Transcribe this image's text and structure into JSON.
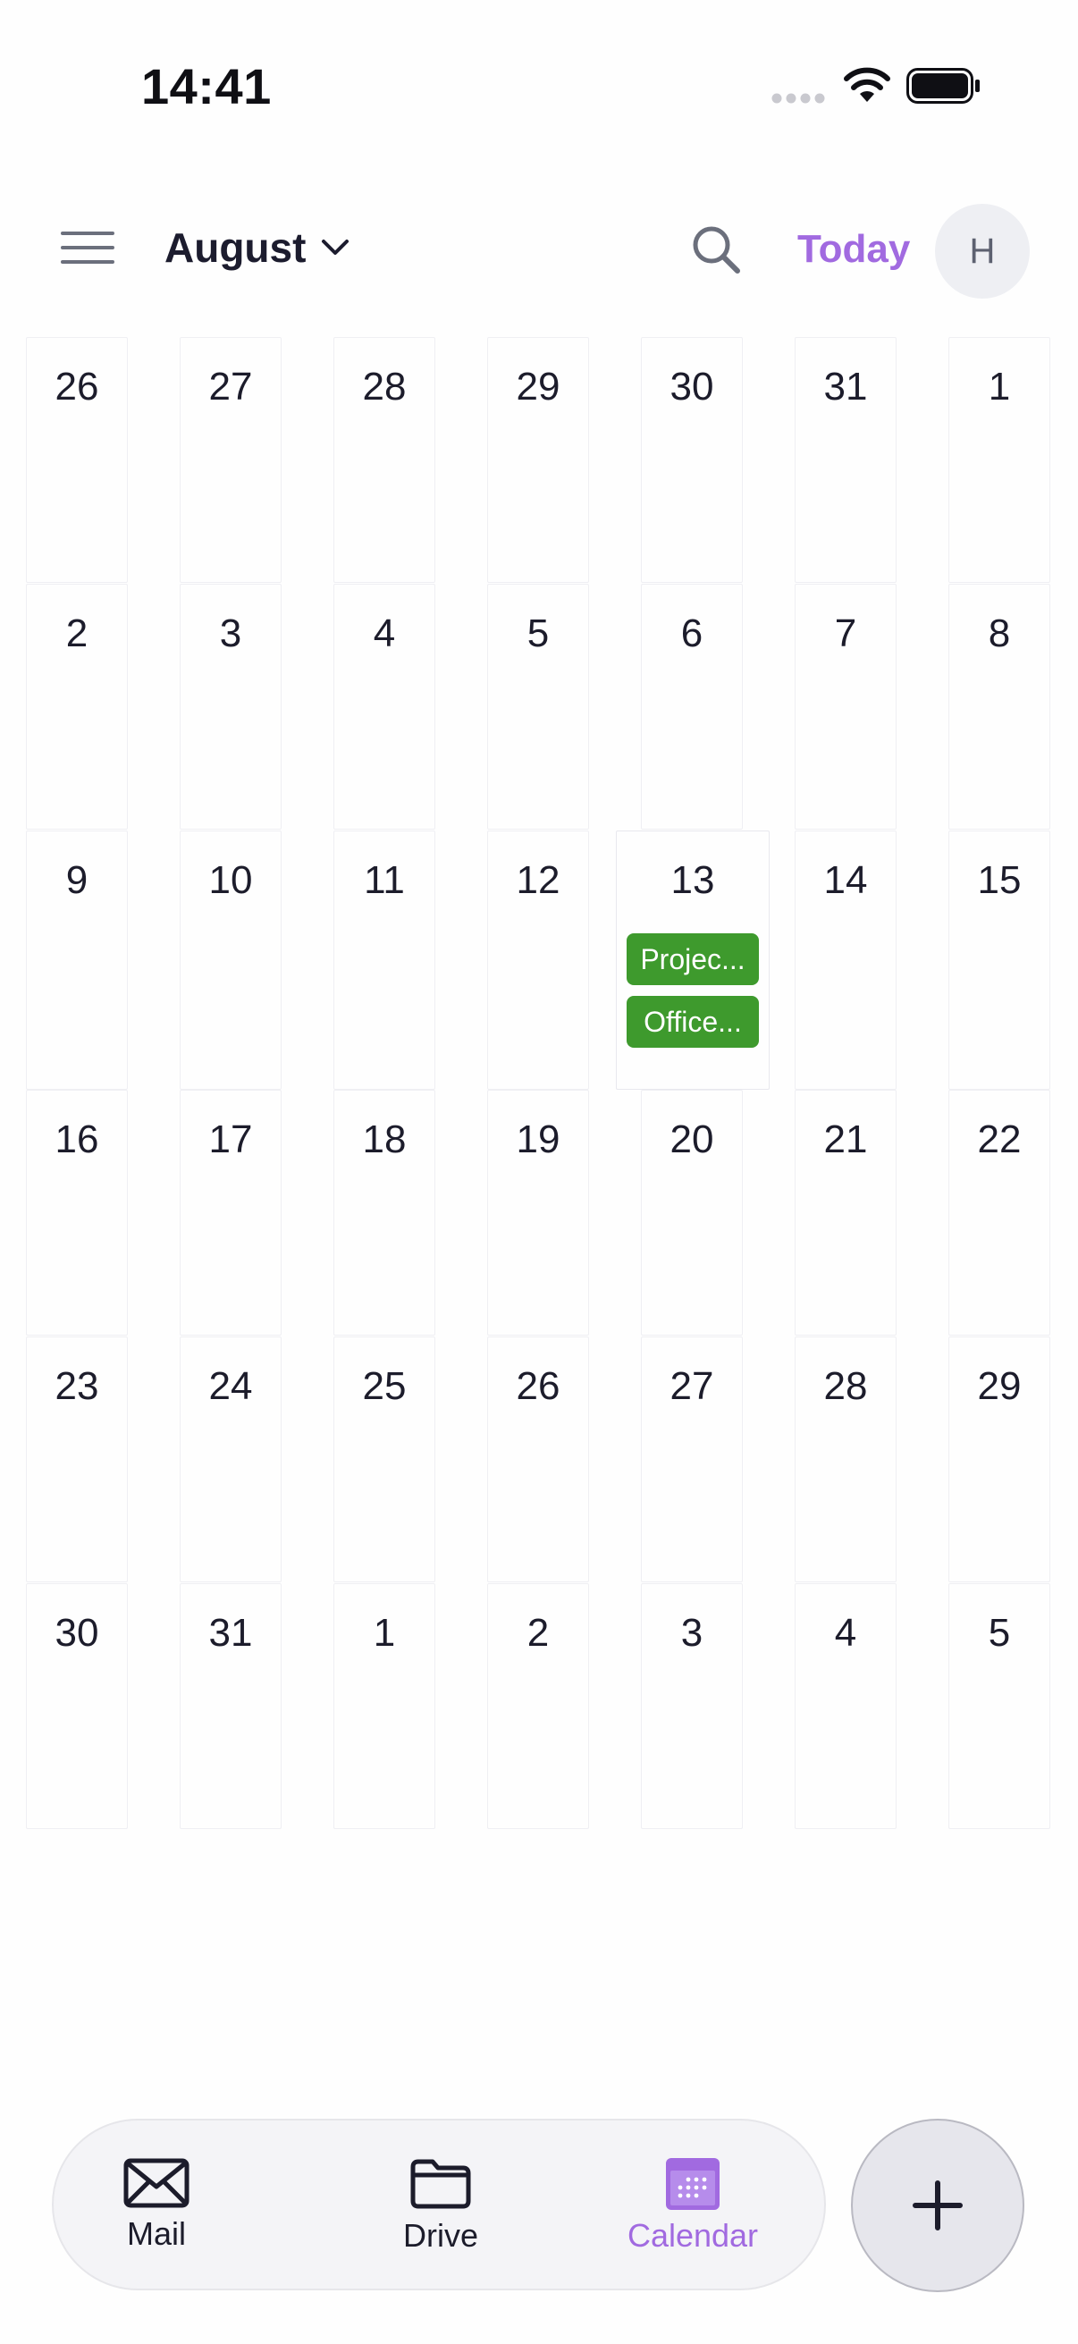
{
  "status_bar": {
    "time": "14:41"
  },
  "header": {
    "month": "August",
    "today_label": "Today",
    "avatar_initial": "H"
  },
  "calendar": {
    "weeks": [
      [
        "26",
        "27",
        "28",
        "29",
        "30",
        "31",
        "1"
      ],
      [
        "2",
        "3",
        "4",
        "5",
        "6",
        "7",
        "8"
      ],
      [
        "9",
        "10",
        "11",
        "12",
        "13",
        "14",
        "15"
      ],
      [
        "16",
        "17",
        "18",
        "19",
        "20",
        "21",
        "22"
      ],
      [
        "23",
        "24",
        "25",
        "26",
        "27",
        "28",
        "29"
      ],
      [
        "30",
        "31",
        "1",
        "2",
        "3",
        "4",
        "5"
      ]
    ],
    "selected_day": "13",
    "events": [
      {
        "label": "Projec...",
        "color": "#3e9a2d"
      },
      {
        "label": "Office...",
        "color": "#3e9a2d"
      }
    ]
  },
  "bottom_nav": {
    "items": [
      {
        "label": "Mail",
        "icon": "mail-icon",
        "active": false
      },
      {
        "label": "Drive",
        "icon": "folder-icon",
        "active": false
      },
      {
        "label": "Calendar",
        "icon": "calendar-icon",
        "active": true
      }
    ],
    "fab_icon": "plus-icon"
  },
  "colors": {
    "accent": "#a16ae0",
    "event_green": "#3e9a2d",
    "text": "#1c1c2b"
  }
}
